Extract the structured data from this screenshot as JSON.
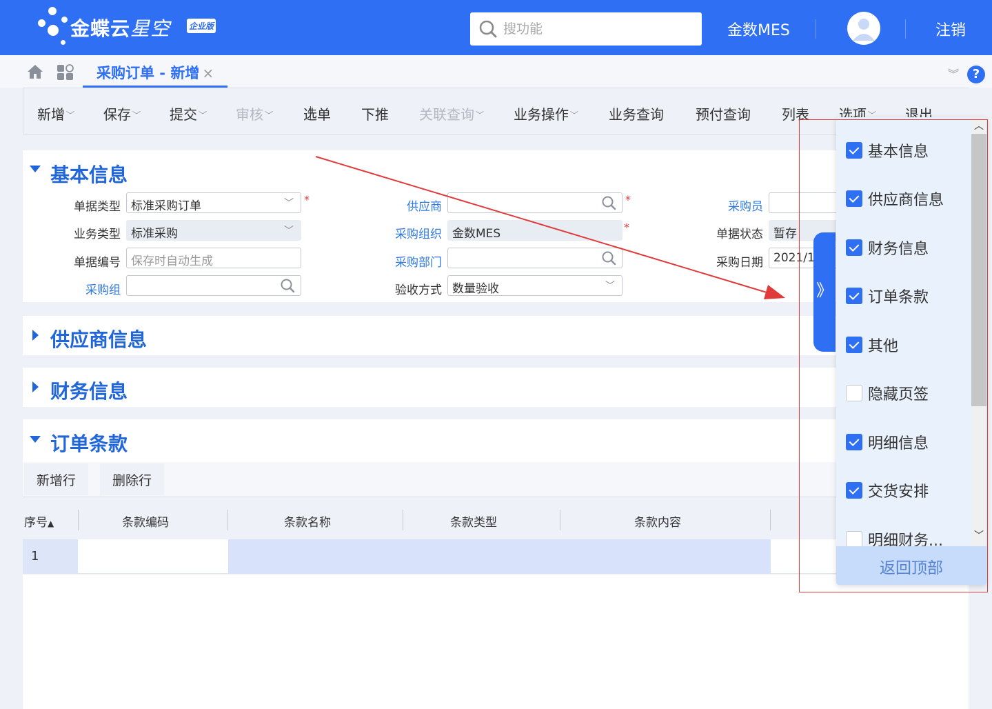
{
  "header": {
    "logo_text": "金蝶云",
    "logo_text_2": "星空",
    "logo_badge": "企业版",
    "search_placeholder": "搜功能",
    "app_name": "金数MES",
    "logout": "注销"
  },
  "tabs": {
    "active_label": "采购订单 - 新增",
    "close_glyph": "×"
  },
  "toolbar": {
    "items": [
      {
        "label": "新增",
        "dropdown": true,
        "disabled": false
      },
      {
        "label": "保存",
        "dropdown": true,
        "disabled": false
      },
      {
        "label": "提交",
        "dropdown": true,
        "disabled": false
      },
      {
        "label": "审核",
        "dropdown": true,
        "disabled": true
      },
      {
        "label": "选单",
        "dropdown": false,
        "disabled": false
      },
      {
        "label": "下推",
        "dropdown": false,
        "disabled": false
      },
      {
        "label": "关联查询",
        "dropdown": true,
        "disabled": true
      },
      {
        "label": "业务操作",
        "dropdown": true,
        "disabled": false
      },
      {
        "label": "业务查询",
        "dropdown": false,
        "disabled": false
      },
      {
        "label": "预付查询",
        "dropdown": false,
        "disabled": false
      },
      {
        "label": "列表",
        "dropdown": false,
        "disabled": false
      },
      {
        "label": "选项",
        "dropdown": true,
        "disabled": false
      },
      {
        "label": "退出",
        "dropdown": false,
        "disabled": false
      }
    ]
  },
  "sections": {
    "basic": "基本信息",
    "supplier": "供应商信息",
    "finance": "财务信息",
    "terms": "订单条款"
  },
  "basic_form": {
    "bill_type_label": "单据类型",
    "bill_type_value": "标准采购订单",
    "biz_type_label": "业务类型",
    "biz_type_value": "标准采购",
    "bill_no_label": "单据编号",
    "bill_no_placeholder": "保存时自动生成",
    "purchase_group_label": "采购组",
    "supplier_label": "供应商",
    "purchase_org_label": "采购组织",
    "purchase_org_value": "金数MES",
    "purchase_dept_label": "采购部门",
    "accept_method_label": "验收方式",
    "accept_method_value": "数量验收",
    "buyer_label": "采购员",
    "bill_status_label": "单据状态",
    "bill_status_value": "暂存",
    "purchase_date_label": "采购日期",
    "purchase_date_value": "2021/1",
    "required_mark": "*"
  },
  "terms_grid": {
    "add_row": "新增行",
    "delete_row": "删除行",
    "columns": [
      "序号",
      "条款编码",
      "条款名称",
      "条款类型",
      "条款内容"
    ],
    "rows": [
      {
        "seq": "1"
      }
    ]
  },
  "side_nav": {
    "toggle_glyph": "》",
    "items": [
      {
        "label": "基本信息",
        "checked": true
      },
      {
        "label": "供应商信息",
        "checked": true
      },
      {
        "label": "财务信息",
        "checked": true
      },
      {
        "label": "订单条款",
        "checked": true
      },
      {
        "label": "其他",
        "checked": true
      },
      {
        "label": "隐藏页签",
        "checked": false
      },
      {
        "label": "明细信息",
        "checked": true
      },
      {
        "label": "交货安排",
        "checked": true
      },
      {
        "label": "明细财务...",
        "checked": false
      }
    ],
    "back_to_top": "返回顶部"
  },
  "colors": {
    "brand": "#2f6ff3",
    "link": "#2f79e0",
    "section_title": "#2166d8",
    "required": "#e03a3a",
    "annotation": "#e03a3a"
  }
}
